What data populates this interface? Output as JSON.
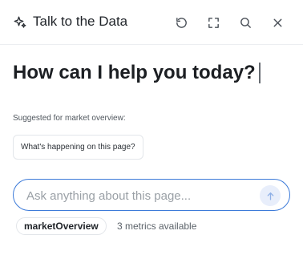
{
  "header": {
    "title": "Talk to the Data",
    "title_icon": "sparkle-icon",
    "actions": [
      {
        "name": "reset",
        "icon": "refresh-icon"
      },
      {
        "name": "expand",
        "icon": "expand-icon"
      },
      {
        "name": "search",
        "icon": "search-icon"
      },
      {
        "name": "close",
        "icon": "close-icon"
      }
    ]
  },
  "hero": {
    "heading": "How can I help you today?"
  },
  "suggestions": {
    "label": "Suggested for market overview:",
    "items": [
      "What's happening on this page?"
    ]
  },
  "input": {
    "placeholder": "Ask anything about this page...",
    "value": "",
    "send_icon": "arrow-up-icon"
  },
  "context": {
    "name": "marketOverview",
    "meta": "3 metrics available"
  },
  "colors": {
    "accent_border": "#3d7bd9",
    "send_bg": "#e8eefb",
    "send_icon": "#8fb0e6",
    "text": "#1f2328",
    "muted": "#5c636a"
  }
}
